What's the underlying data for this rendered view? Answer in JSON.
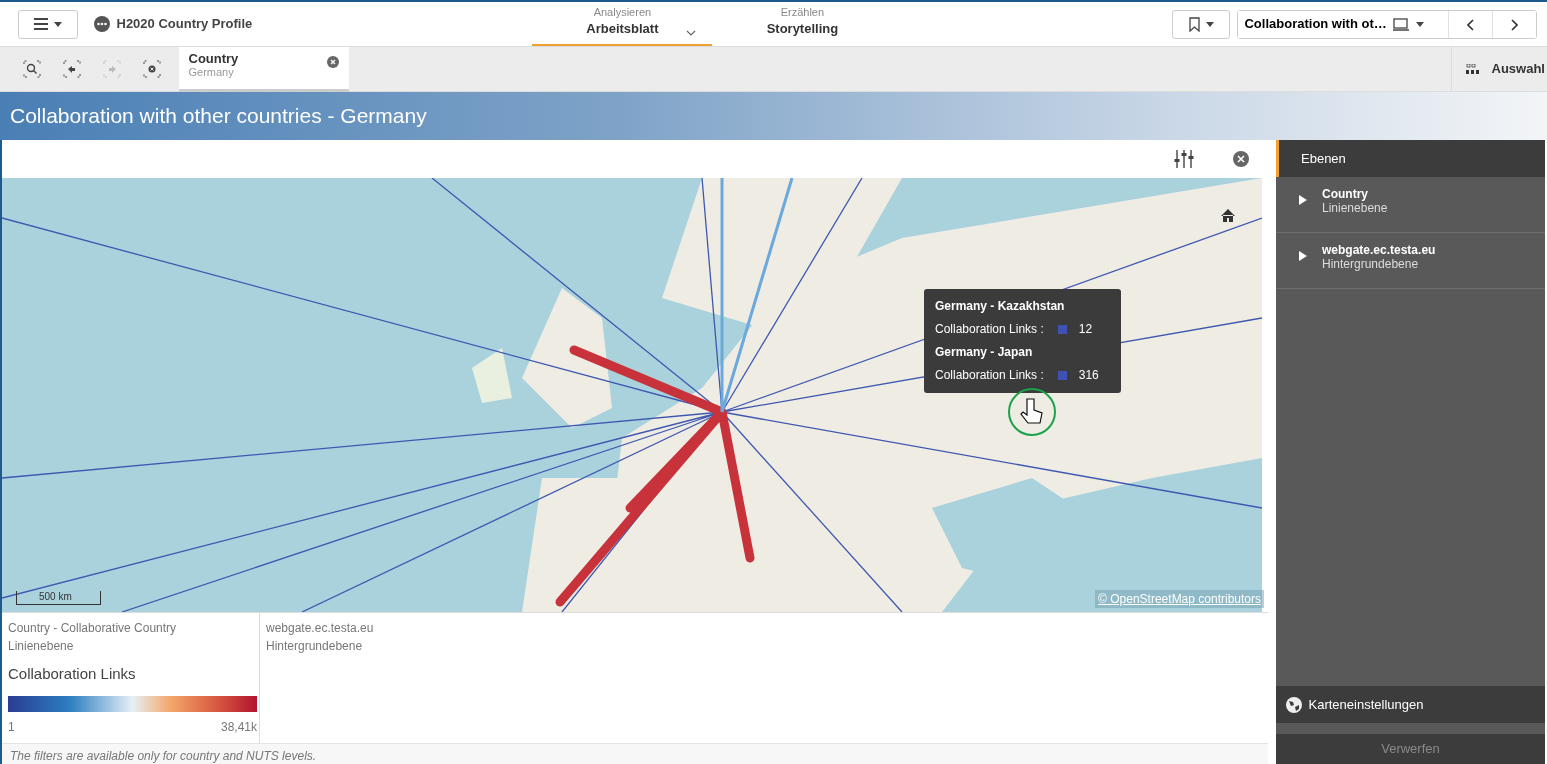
{
  "header": {
    "app_title": "H2020 Country Profile",
    "nav_tabs": [
      {
        "caption": "Analysieren",
        "label": "Arbeitsblatt",
        "selected": true,
        "has_dropdown": true
      },
      {
        "caption": "Erzählen",
        "label": "Storytelling",
        "selected": false,
        "has_dropdown": false
      }
    ],
    "sheet_selector": {
      "label": "Collaboration with ot…"
    }
  },
  "selection_bar": {
    "tools": [
      {
        "kind": "search",
        "disabled": false
      },
      {
        "kind": "back",
        "disabled": false
      },
      {
        "kind": "forward",
        "disabled": true
      },
      {
        "kind": "clear",
        "disabled": false
      }
    ],
    "filter": {
      "field": "Country",
      "value": "Germany"
    },
    "selections_label": "Auswahl"
  },
  "sheet_title": "Collaboration with other countries - Germany",
  "map": {
    "scale": "500 km",
    "attribution": "© OpenStreetMap contributors",
    "tooltip": [
      {
        "title": "Germany - Kazakhstan",
        "label": "Collaboration Links :",
        "value": "12",
        "color": "#3f51b5"
      },
      {
        "title": "Germany - Japan",
        "label": "Collaboration Links :",
        "value": "316",
        "color": "#3f51b5"
      }
    ]
  },
  "legend": [
    {
      "title": "Country - Collaborative Country",
      "type": "Linienebene",
      "measure": "Collaboration Links",
      "min": "1",
      "max": "38,41k"
    },
    {
      "title": "webgate.ec.testa.eu",
      "type": "Hintergrundebene"
    }
  ],
  "note": "The filters are available only for country and NUTS levels.",
  "layers_panel": {
    "title": "Ebenen",
    "items": [
      {
        "name": "Country",
        "type": "Linienebene",
        "expanded": false
      },
      {
        "name": "webgate.ec.testa.eu",
        "type": "Hintergrundebene",
        "expanded": false
      }
    ],
    "settings": "Karteneinstellungen",
    "discard": {
      "label": "Verwerfen",
      "disabled": true
    }
  }
}
